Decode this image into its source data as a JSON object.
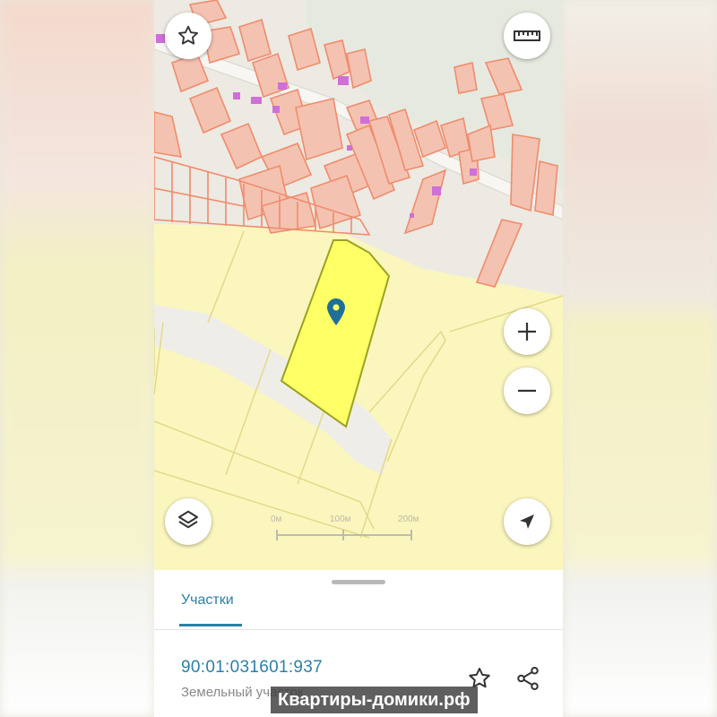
{
  "map": {
    "scale_labels": [
      "0м",
      "100м",
      "200м"
    ],
    "selected_parcel_color": "#ffff66",
    "building_color": "#ef8c6d",
    "land_color": "#fbf6be",
    "controls": {
      "favorites_icon": "star-outline-icon",
      "ruler_icon": "ruler-icon",
      "zoom_in_icon": "plus-icon",
      "zoom_out_icon": "minus-icon",
      "layers_icon": "layers-icon",
      "location_icon": "navigation-arrow-icon"
    }
  },
  "sheet": {
    "tab_label": "Участки",
    "parcel_number": "90:01:031601:937",
    "parcel_type": "Земельный участок",
    "accent_color": "#2d7fa6",
    "favorite_icon": "star-outline-icon",
    "share_icon": "share-icon"
  },
  "watermark": "Квартиры-домики.рф"
}
